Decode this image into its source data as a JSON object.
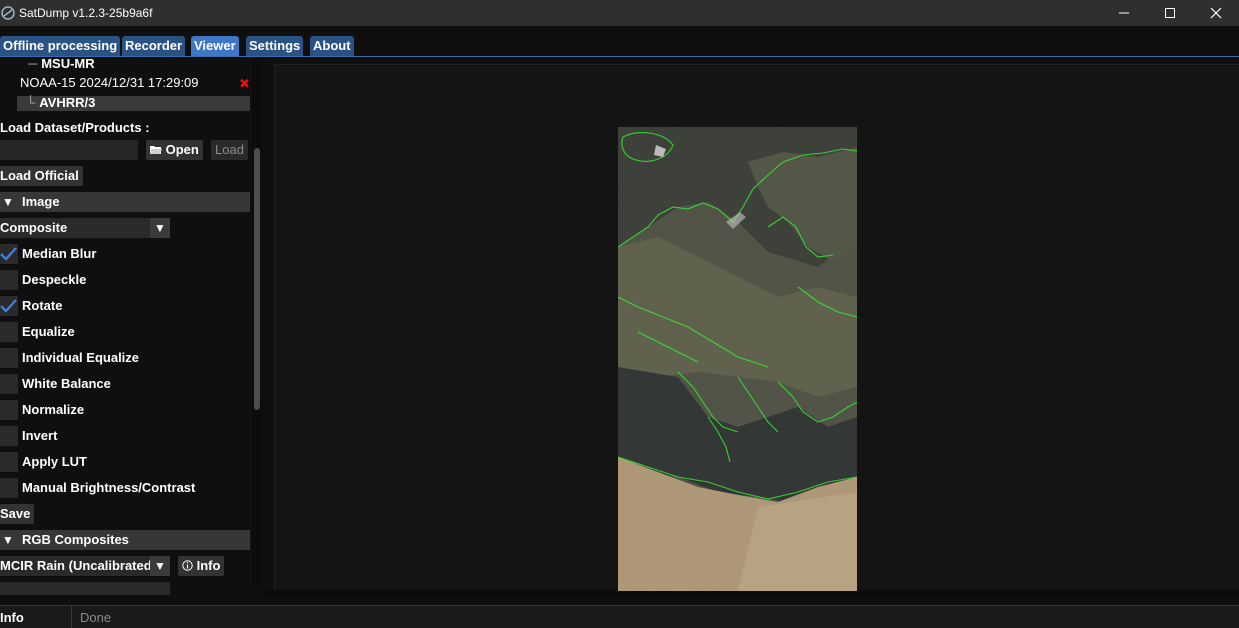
{
  "window": {
    "title": "SatDump v1.2.3-25b9a6f",
    "minimize": "—",
    "maximize": "☐",
    "close": "✕"
  },
  "tabs": [
    {
      "label": "Offline processing",
      "active": false
    },
    {
      "label": "Recorder",
      "active": false
    },
    {
      "label": "Viewer",
      "active": true
    },
    {
      "label": "Settings",
      "active": false
    },
    {
      "label": "About",
      "active": false
    }
  ],
  "tree": {
    "partial_item": "MSU-MR",
    "dataset": "NOAA-15 2024/12/31 17:29:09",
    "delete_icon": "✖",
    "selected_item": "AVHRR/3",
    "branch_glyph": "└",
    "partial_glyph": "─"
  },
  "load": {
    "label": "Load Dataset/Products :",
    "input_value": "",
    "open_label": "Open",
    "load_label": "Load",
    "official_label": "Load Official"
  },
  "image_section": {
    "title": "Image",
    "arrow": "▼",
    "composite_value": "Composite",
    "options": [
      {
        "label": "Median Blur",
        "checked": true
      },
      {
        "label": "Despeckle",
        "checked": false
      },
      {
        "label": "Rotate",
        "checked": true
      },
      {
        "label": "Equalize",
        "checked": false
      },
      {
        "label": "Individual Equalize",
        "checked": false
      },
      {
        "label": "White Balance",
        "checked": false
      },
      {
        "label": "Normalize",
        "checked": false
      },
      {
        "label": "Invert",
        "checked": false
      },
      {
        "label": "Apply LUT",
        "checked": false
      },
      {
        "label": "Manual Brightness/Contrast",
        "checked": false
      }
    ],
    "save_label": "Save"
  },
  "rgb_section": {
    "title": "RGB Composites",
    "arrow": "▼",
    "select_value": "MCIR Rain (Uncalibrated",
    "info_label": "Info"
  },
  "status": {
    "label": "Info",
    "text": "Done"
  },
  "colors": {
    "tab": "#2a5285",
    "tab_active": "#3f76c5",
    "check": "#3f7fd6",
    "delete": "#e01010",
    "coastline": "#2ee82e"
  },
  "icons": {
    "app": "satdump-icon",
    "folder": "folder-open-icon",
    "info": "info-circle-icon"
  }
}
